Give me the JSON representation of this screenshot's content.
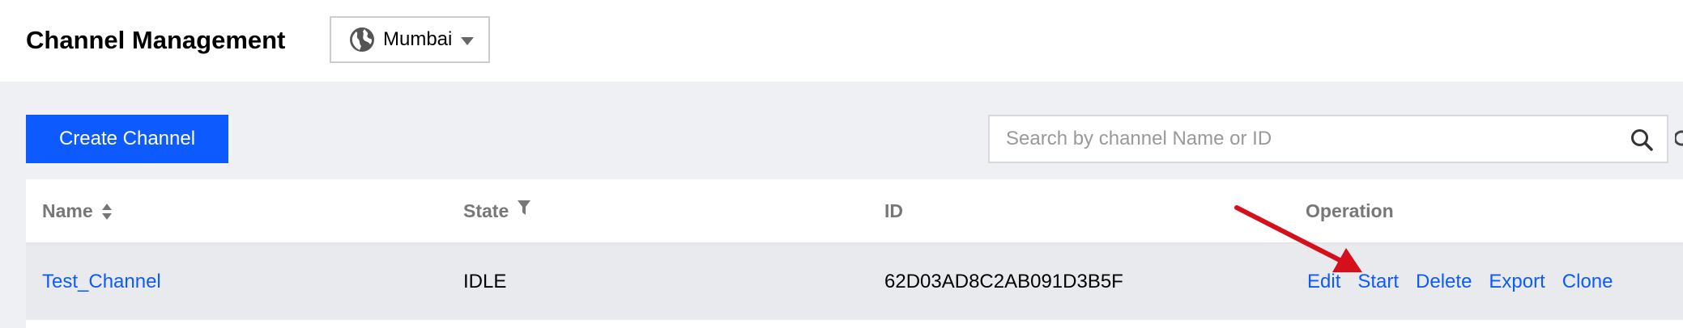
{
  "header": {
    "title": "Channel Management",
    "region": {
      "selected": "Mumbai",
      "icon": "globe-icon"
    }
  },
  "toolbar": {
    "create_label": "Create Channel",
    "search_placeholder": "Search by channel Name or ID",
    "search_value": ""
  },
  "table": {
    "columns": {
      "name": "Name",
      "state": "State",
      "id": "ID",
      "operation": "Operation"
    },
    "rows": [
      {
        "name": "Test_Channel",
        "state": "IDLE",
        "id": "62D03AD8C2AB091D3B5F",
        "operations": [
          "Edit",
          "Start",
          "Delete",
          "Export",
          "Clone"
        ]
      }
    ]
  },
  "colors": {
    "accent": "#0d5bff",
    "annotation_arrow": "#d50f1c",
    "page_bg": "#eff0f4"
  }
}
